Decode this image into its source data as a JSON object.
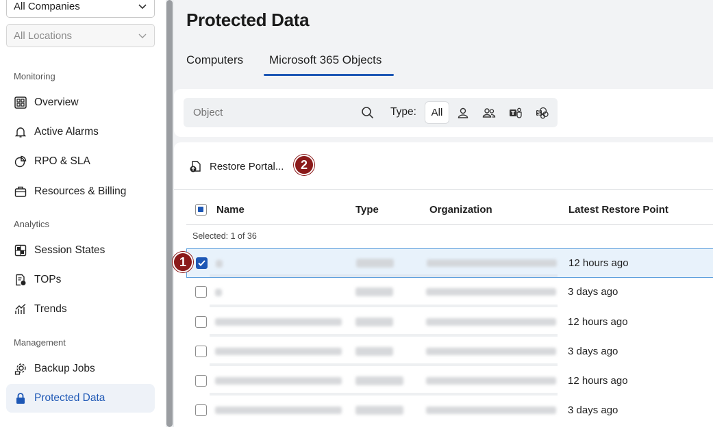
{
  "sidebar": {
    "company_select": "All Companies",
    "location_select": "All Locations",
    "sections": {
      "monitoring": "Monitoring",
      "analytics": "Analytics",
      "management": "Management"
    },
    "items": [
      {
        "label": "Overview",
        "icon": "overview-icon"
      },
      {
        "label": "Active Alarms",
        "icon": "bell-icon"
      },
      {
        "label": "RPO & SLA",
        "icon": "pie-chart-icon"
      },
      {
        "label": "Resources & Billing",
        "icon": "briefcase-icon"
      },
      {
        "label": "Session States",
        "icon": "grid-icon"
      },
      {
        "label": "TOPs",
        "icon": "report-icon"
      },
      {
        "label": "Trends",
        "icon": "trend-icon"
      },
      {
        "label": "Backup Jobs",
        "icon": "backup-gear-icon"
      },
      {
        "label": "Protected Data",
        "icon": "lock-icon",
        "active": true
      }
    ]
  },
  "main": {
    "title": "Protected Data",
    "tabs": [
      "Computers",
      "Microsoft 365 Objects"
    ],
    "active_tab": "Microsoft 365 Objects",
    "search_placeholder": "Object",
    "type_label": "Type:",
    "type_all": "All",
    "type_icons": [
      "user-icon",
      "group-icon",
      "teams-icon",
      "sharepoint-icon"
    ],
    "restore_label": "Restore Portal...",
    "badges": [
      "1",
      "2"
    ],
    "columns": [
      "Name",
      "Type",
      "Organization",
      "Latest Restore Point"
    ],
    "selected_info": "Selected: 1 of 36",
    "rows": [
      {
        "restore_point": "12 hours ago",
        "checked": true
      },
      {
        "restore_point": "3 days ago",
        "checked": false
      },
      {
        "restore_point": "12 hours ago",
        "checked": false
      },
      {
        "restore_point": "3 days ago",
        "checked": false
      },
      {
        "restore_point": "12 hours ago",
        "checked": false
      },
      {
        "restore_point": "3 days ago",
        "checked": false
      }
    ]
  },
  "colors": {
    "accent": "#1d57b5",
    "badge": "#8b1a1a",
    "selected_row": "#e8f2fb"
  }
}
